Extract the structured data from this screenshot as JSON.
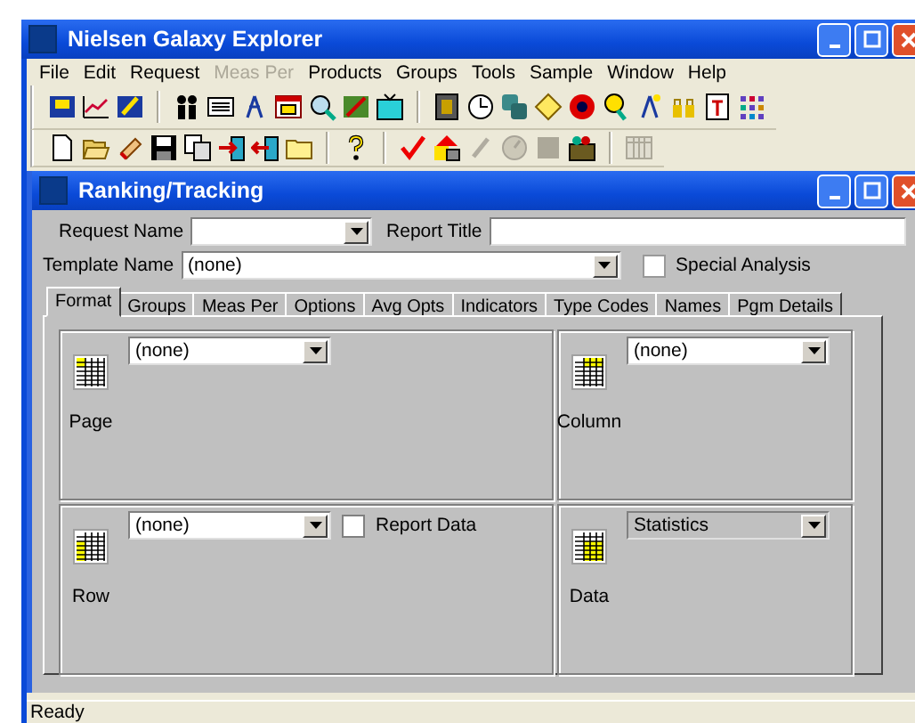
{
  "window": {
    "title": "Nielsen Galaxy Explorer"
  },
  "menu": [
    {
      "label": "File",
      "disabled": false
    },
    {
      "label": "Edit",
      "disabled": false
    },
    {
      "label": "Request",
      "disabled": false
    },
    {
      "label": "Meas Per",
      "disabled": true
    },
    {
      "label": "Products",
      "disabled": false
    },
    {
      "label": "Groups",
      "disabled": false
    },
    {
      "label": "Tools",
      "disabled": false
    },
    {
      "label": "Sample",
      "disabled": false
    },
    {
      "label": "Window",
      "disabled": false
    },
    {
      "label": "Help",
      "disabled": false
    }
  ],
  "child_window": {
    "title": "Ranking/Tracking",
    "request_name": {
      "label": "Request Name"
    },
    "report_title": {
      "label": "Report Title"
    },
    "template_name": {
      "label": "Template Name",
      "value": "(none)"
    },
    "special_analysis": {
      "label": "Special Analysis",
      "checked": false
    },
    "tabs": [
      {
        "label": "Format",
        "selected": true
      },
      {
        "label": "Groups",
        "selected": false
      },
      {
        "label": "Meas Per",
        "selected": false
      },
      {
        "label": "Options",
        "selected": false
      },
      {
        "label": "Avg Opts",
        "selected": false
      },
      {
        "label": "Indicators",
        "selected": false
      },
      {
        "label": "Type Codes",
        "selected": false
      },
      {
        "label": "Names",
        "selected": false
      },
      {
        "label": "Pgm Details",
        "selected": false
      }
    ],
    "panels": [
      {
        "label": "Page",
        "value": "(none)",
        "disabled": false
      },
      {
        "label": "Column",
        "value": "(none)",
        "disabled": false
      },
      {
        "label": "Row",
        "value": "(none)",
        "disabled": false,
        "checkbox": {
          "label": "Report Data",
          "checked": false
        }
      },
      {
        "label": "Data",
        "value": "Statistics",
        "disabled": true
      }
    ]
  },
  "status_bar": "Ready"
}
